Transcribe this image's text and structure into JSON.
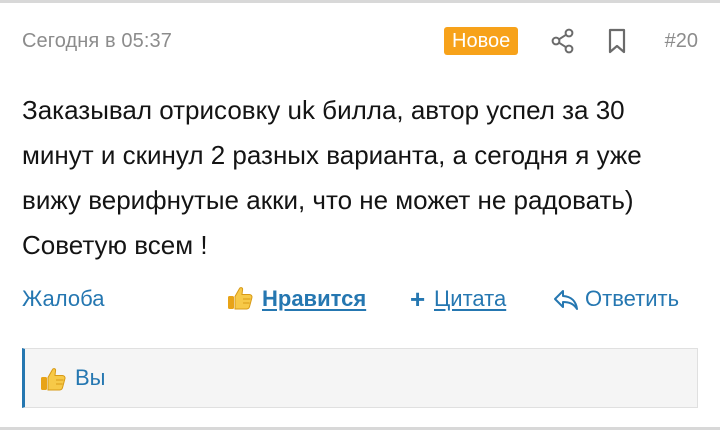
{
  "post": {
    "timestamp": "Сегодня в 05:37",
    "badge": "Новое",
    "post_number": "#20",
    "message": "Заказывал отрисовку uk билла, автор успел за 30 минут и скинул 2 разных варианта, а сегодня я уже вижу верифнутые акки, что не может не радовать) Советую всем !"
  },
  "actions": {
    "report": "Жалоба",
    "like": "Нравится",
    "quote": "Цитата",
    "reply": "Ответить"
  },
  "reactions": {
    "text": "Вы"
  },
  "icons": {
    "share": "share-icon",
    "bookmark": "bookmark-icon",
    "like": "thumbs-up-icon",
    "quote": "plus-icon",
    "reply": "reply-arrow-icon"
  },
  "colors": {
    "link": "#2577b1",
    "badge_bg": "#f7a21a",
    "muted_text": "#8c8c8c",
    "body_text": "#141414",
    "reactions_bg": "#f5f5f5"
  }
}
